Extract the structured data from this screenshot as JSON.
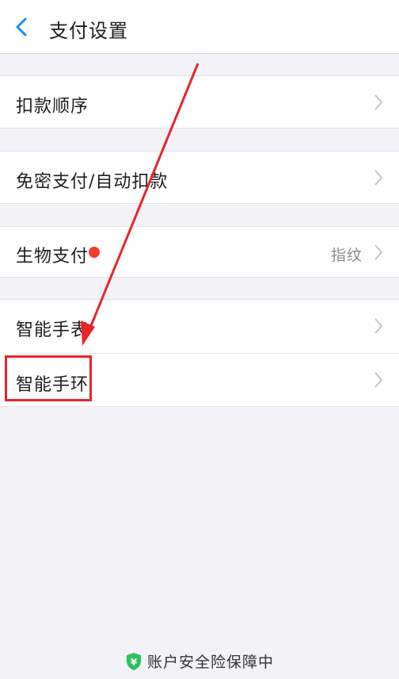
{
  "navbar": {
    "title": "支付设置"
  },
  "menu": {
    "deduction_order": "扣款顺序",
    "password_free": "免密支付/自动扣款",
    "biometric": {
      "label": "生物支付",
      "value": "指纹"
    },
    "smart_watch": "智能手表",
    "smart_band": "智能手环"
  },
  "footer": {
    "text": "账户安全险保障中"
  },
  "annotation": {
    "highlight_color": "#e5262b",
    "arrow_color": "#e5262b"
  },
  "colors": {
    "accent": "#1a8cff",
    "background": "#f2f2f7",
    "badge_red": "#f23b2f",
    "shield_green": "#2fbf5f"
  }
}
